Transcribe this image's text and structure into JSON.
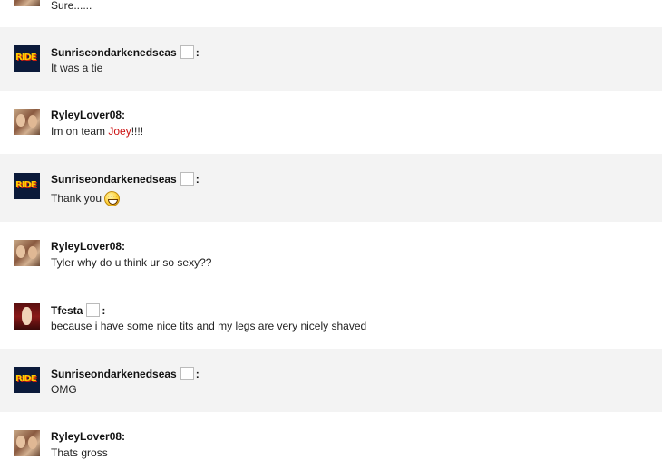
{
  "messages": [
    {
      "user": "",
      "text": "Sure......",
      "avatar": "ryley-avatar"
    },
    {
      "user": "Sunriseondarkenedseas",
      "text": "It was a tie",
      "avatar": "sunrise-avatar"
    },
    {
      "user": "RyleyLover08:",
      "text_before": "Im on team ",
      "text_highlight": "Joey",
      "text_after": "!!!!",
      "avatar": "ryley-avatar"
    },
    {
      "user": "Sunriseondarkenedseas",
      "text": "Thank you",
      "emoji": "smiley-icon",
      "avatar": "sunrise-avatar"
    },
    {
      "user": "RyleyLover08:",
      "text": "Tyler why do u think ur so sexy??",
      "avatar": "ryley-avatar"
    },
    {
      "user": "Tfesta",
      "text": "because i have some nice tits and my legs are very nicely shaved",
      "avatar": "tfesta-avatar"
    },
    {
      "user": "Sunriseondarkenedseas",
      "text": "OMG",
      "avatar": "sunrise-avatar"
    },
    {
      "user": "RyleyLover08:",
      "text": "Thats gross",
      "avatar": "ryley-avatar"
    }
  ],
  "colon": ":",
  "sunrise_avatar_art": "RIDE",
  "colors": {
    "alt_row": "#f3f3f3",
    "highlight": "#cc1111"
  }
}
